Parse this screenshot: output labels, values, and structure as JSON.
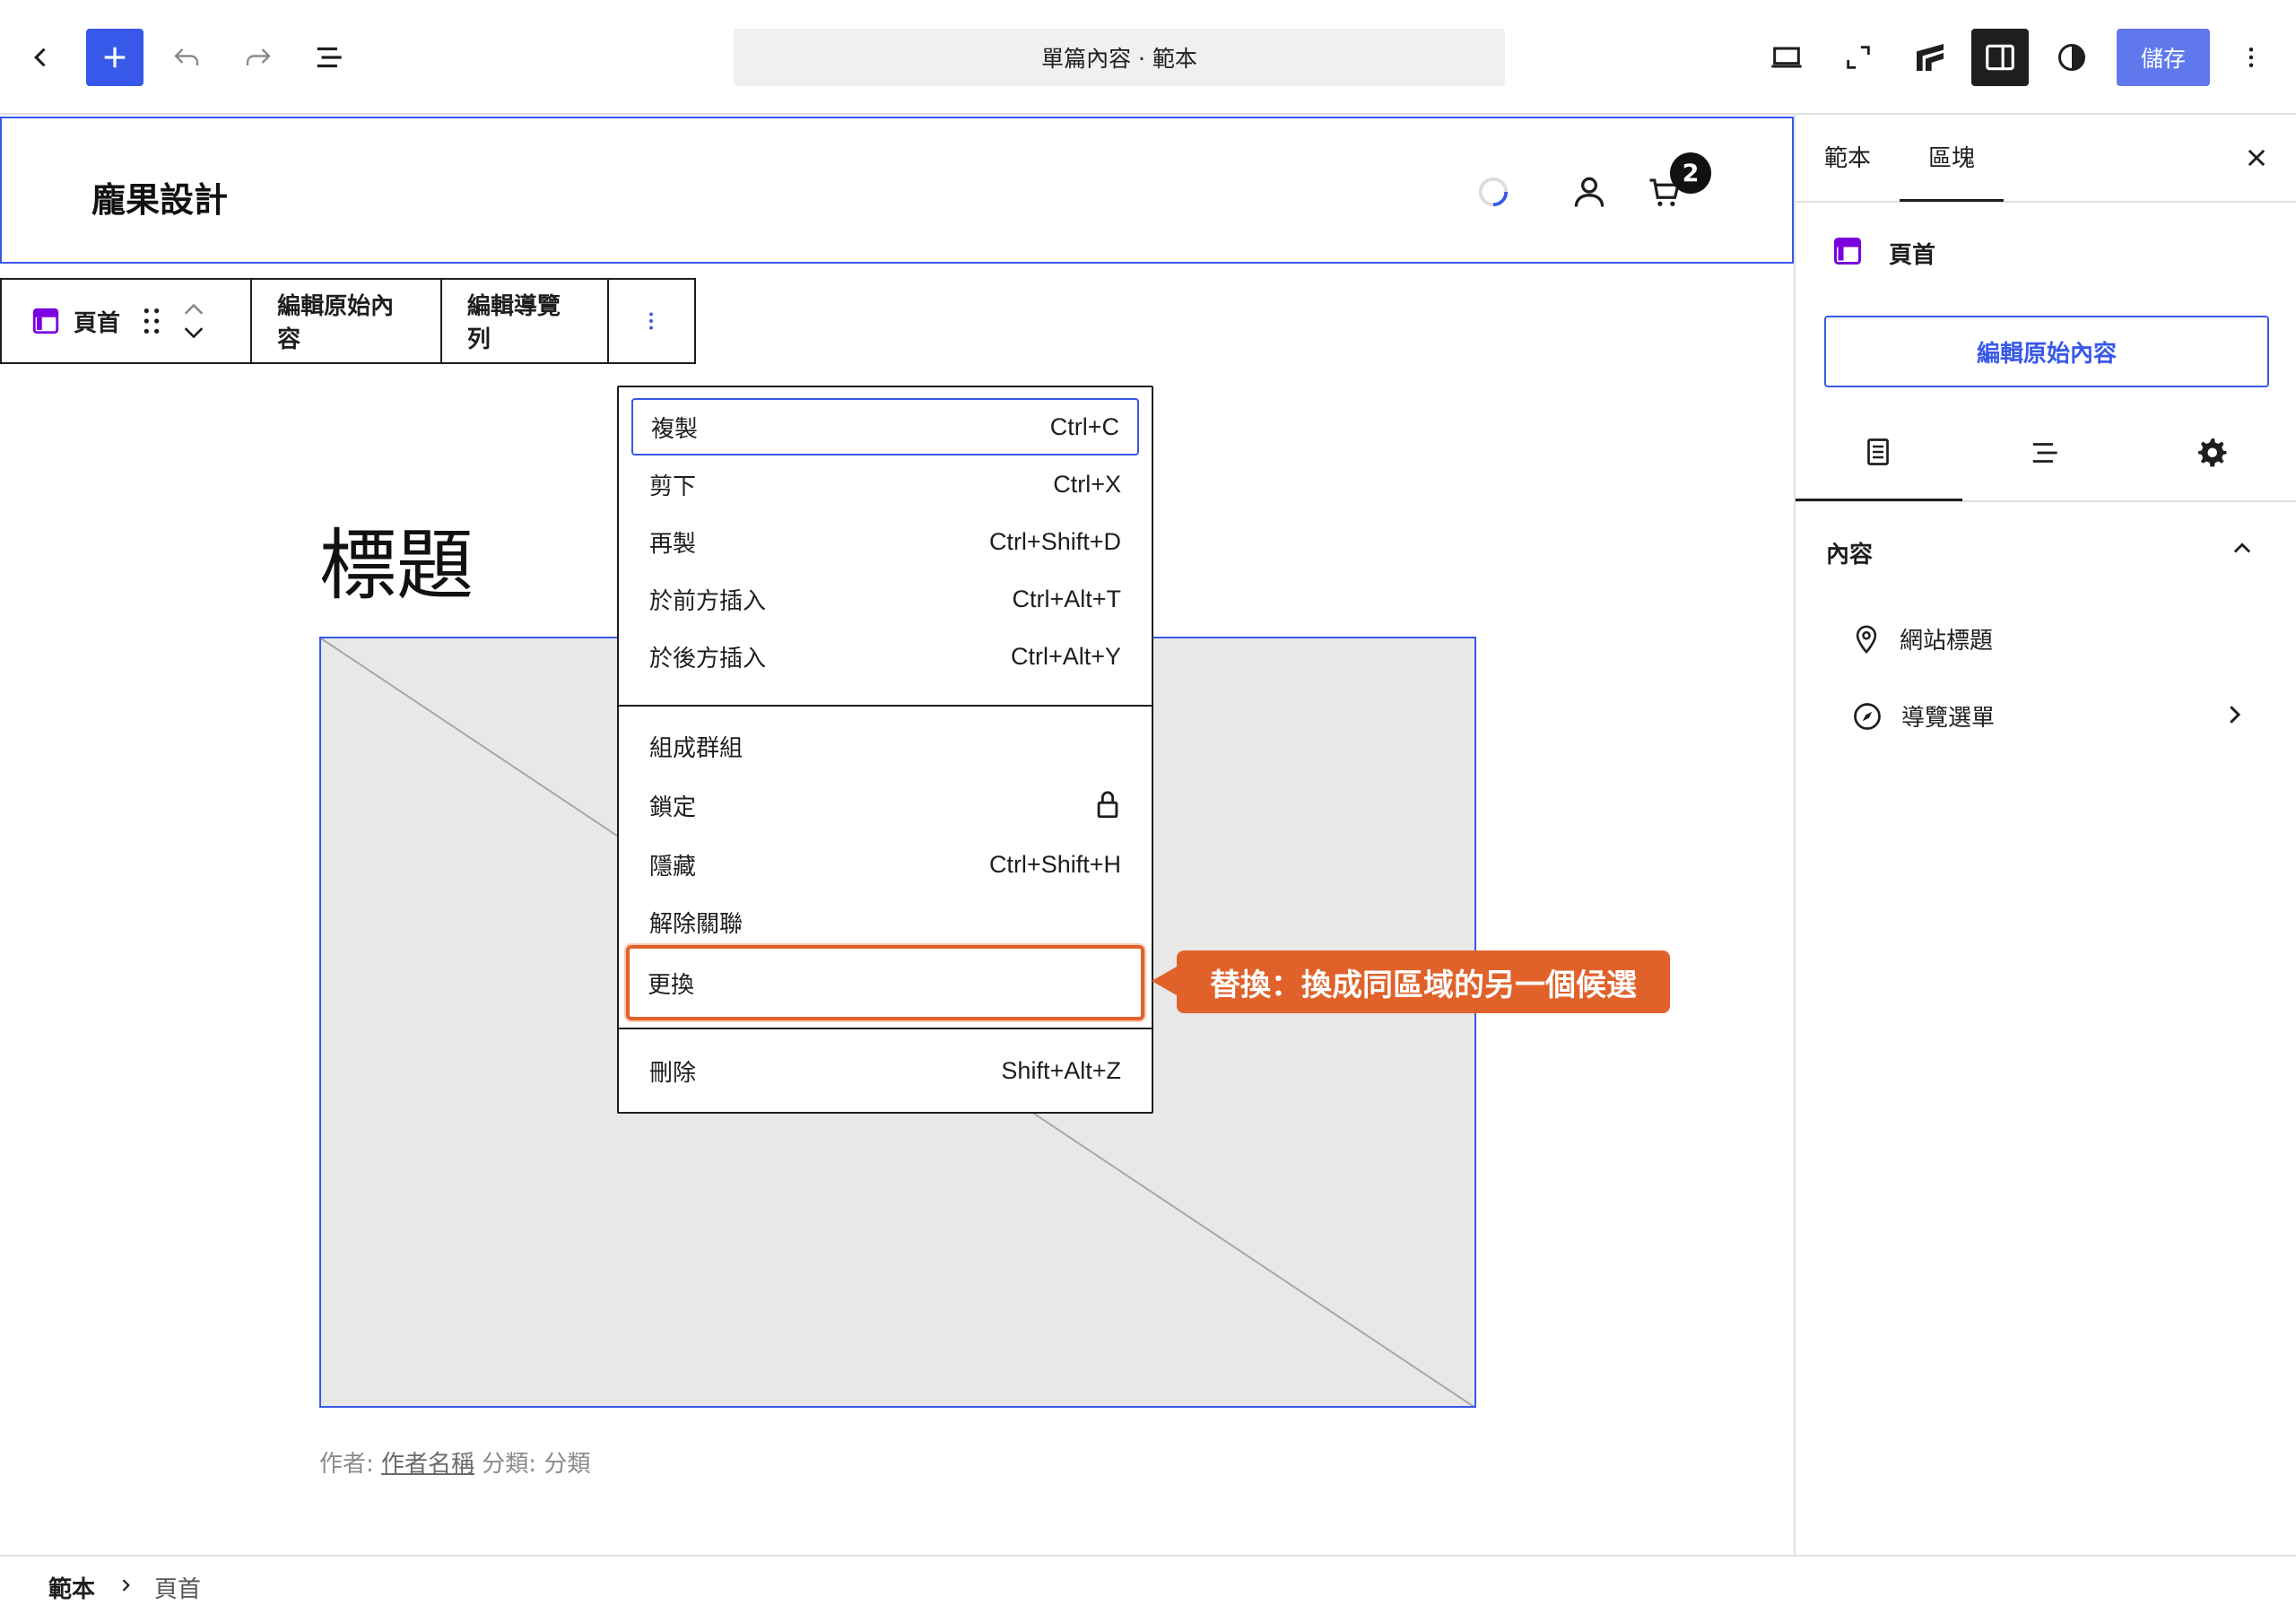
{
  "topbar": {
    "document_title": "單篇內容 · 範本",
    "save_label": "儲存"
  },
  "header": {
    "site_title": "龐果設計",
    "cart_count": "2"
  },
  "block_toolbar": {
    "block_label": "頁首",
    "edit_original_label": "編輯原始內容",
    "edit_navigation_label": "編輯導覽列"
  },
  "post": {
    "title": "標題",
    "meta_author_prefix": "作者: ",
    "meta_author": "作者名稱",
    "meta_category": " 分類: 分類"
  },
  "context_menu": {
    "items": [
      {
        "label": "複製",
        "shortcut": "Ctrl+C"
      },
      {
        "label": "剪下",
        "shortcut": "Ctrl+X"
      },
      {
        "label": "再製",
        "shortcut": "Ctrl+Shift+D"
      },
      {
        "label": "於前方插入",
        "shortcut": "Ctrl+Alt+T"
      },
      {
        "label": "於後方插入",
        "shortcut": "Ctrl+Alt+Y"
      },
      {
        "label": "組成群組",
        "shortcut": ""
      },
      {
        "label": "鎖定",
        "shortcut": ""
      },
      {
        "label": "隱藏",
        "shortcut": "Ctrl+Shift+H"
      },
      {
        "label": "解除關聯",
        "shortcut": ""
      },
      {
        "label": "更換",
        "shortcut": ""
      },
      {
        "label": "刪除",
        "shortcut": "Shift+Alt+Z"
      }
    ]
  },
  "callout": {
    "text": "替換：換成同區域的另一個候選",
    "color": "#e0622a"
  },
  "sidebar": {
    "tabs": [
      "範本",
      "區塊"
    ],
    "active_tab": "區塊",
    "block_name": "頁首",
    "edit_original_label": "編輯原始內容",
    "section_title": "內容",
    "list_items": [
      "網站標題",
      "導覽選單"
    ]
  },
  "footer": {
    "breadcrumb_root": "範本",
    "breadcrumb_current": "頁首"
  },
  "colors": {
    "accent": "#3858e9",
    "block_icon": "#7a00df"
  }
}
